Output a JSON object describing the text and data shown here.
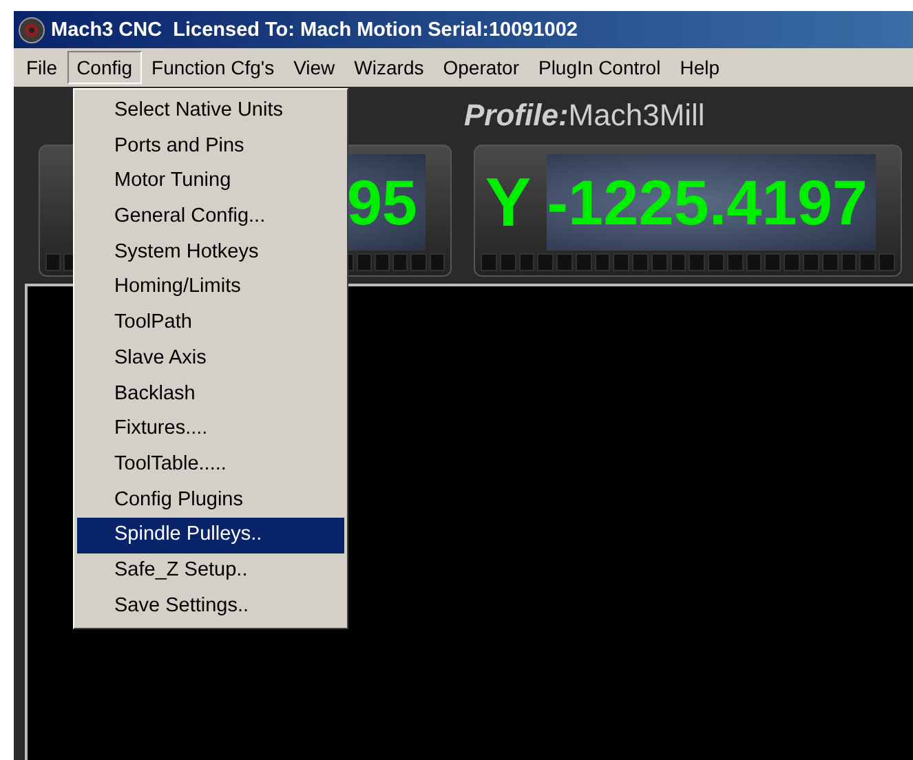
{
  "window": {
    "title": "Mach3 CNC  Licensed To: Mach Motion Serial:10091002"
  },
  "menu_bar": [
    {
      "label": "File",
      "selected": false
    },
    {
      "label": "Config",
      "selected": true
    },
    {
      "label": "Function Cfg's",
      "selected": false
    },
    {
      "label": "View",
      "selected": false
    },
    {
      "label": "Wizards",
      "selected": false
    },
    {
      "label": "Operator",
      "selected": false
    },
    {
      "label": "PlugIn Control",
      "selected": false
    },
    {
      "label": "Help",
      "selected": false
    }
  ],
  "config_menu": [
    {
      "label": "Select Native Units",
      "selected": false
    },
    {
      "label": "Ports and Pins",
      "selected": false
    },
    {
      "label": "Motor Tuning",
      "selected": false
    },
    {
      "label": "General Config...",
      "selected": false
    },
    {
      "label": "System Hotkeys",
      "selected": false
    },
    {
      "label": "Homing/Limits",
      "selected": false
    },
    {
      "label": "ToolPath",
      "selected": false
    },
    {
      "label": "Slave Axis",
      "selected": false
    },
    {
      "label": "Backlash",
      "selected": false
    },
    {
      "label": "Fixtures....",
      "selected": false
    },
    {
      "label": "ToolTable.....",
      "selected": false
    },
    {
      "label": "Config Plugins",
      "selected": false
    },
    {
      "label": "Spindle Pulleys..",
      "selected": true
    },
    {
      "label": "Safe_Z Setup..",
      "selected": false
    },
    {
      "label": "Save Settings..",
      "selected": false
    }
  ],
  "profile": {
    "label": "Profile:",
    "value": "Mach3Mill"
  },
  "dros": [
    {
      "value": "95"
    },
    {
      "axis": "Y",
      "value": "-1225.4197"
    }
  ]
}
